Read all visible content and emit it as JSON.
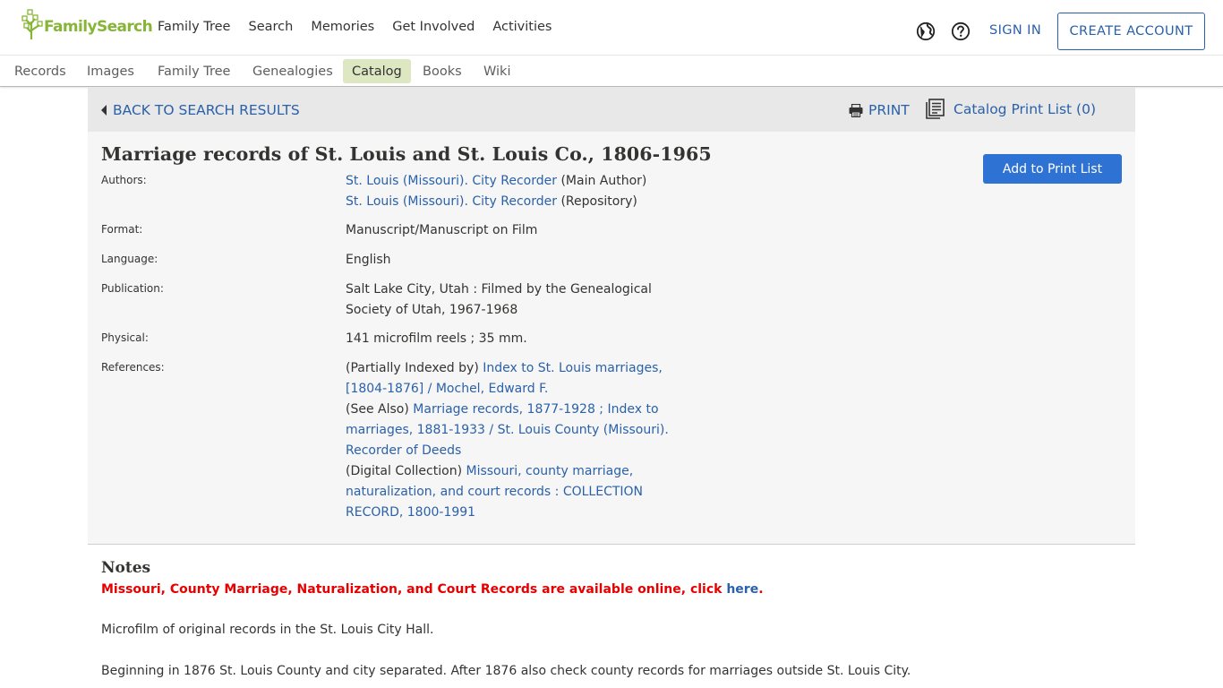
{
  "header": {
    "logo_text": "FamilySearch",
    "nav": [
      "Family Tree",
      "Search",
      "Memories",
      "Get Involved",
      "Activities"
    ],
    "language_icon": "globe-icon",
    "help_icon": "help-circle-icon",
    "sign_in": "SIGN IN",
    "create_account": "CREATE ACCOUNT",
    "brand_color": "#87b537",
    "link_color": "#2b61aa"
  },
  "subnav": {
    "items": [
      "Records",
      "Images",
      "Family Tree",
      "Genealogies",
      "Catalog",
      "Books",
      "Wiki"
    ],
    "active": "Catalog"
  },
  "toolbar": {
    "back": "BACK TO SEARCH RESULTS",
    "print": "PRINT",
    "print_list": "Catalog Print List (0)"
  },
  "record": {
    "title": "Marriage records of St. Louis and St. Louis Co., 1806-1965",
    "add_to_print_list": "Add to Print List",
    "labels": {
      "authors": "Authors:",
      "format": "Format:",
      "language": "Language:",
      "publication": "Publication:",
      "physical": "Physical:",
      "references": "References:"
    },
    "authors": [
      {
        "name": "St. Louis (Missouri). City Recorder",
        "role": "(Main Author)"
      },
      {
        "name": "St. Louis (Missouri). City Recorder",
        "role": "(Repository)"
      }
    ],
    "format": "Manuscript/Manuscript on Film",
    "language": "English",
    "publication": "Salt Lake City, Utah : Filmed by the Genealogical Society of Utah, 1967-1968",
    "physical": "141 microfilm reels ; 35 mm.",
    "references": [
      {
        "prefix": "(Partially Indexed by)",
        "link": "Index to St. Louis marriages, [1804-1876] / Mochel, Edward F."
      },
      {
        "prefix": "(See Also)",
        "link": "Marriage records, 1877-1928 ; Index to marriages, 1881-1933 / St. Louis County (Missouri). Recorder of Deeds"
      },
      {
        "prefix": "(Digital Collection)",
        "link": "Missouri, county marriage, naturalization, and court records : COLLECTION RECORD, 1800-1991"
      }
    ]
  },
  "notes": {
    "title": "Notes",
    "alert": "Missouri, County Marriage, Naturalization, and Court Records are available online, click",
    "alert_link": "here",
    "alert_end": ".",
    "alert_color": "#e60000",
    "paragraphs": [
      "Microfilm of original records in the St. Louis City Hall.",
      "Beginning in 1876 St. Louis County and city separated. After 1876 also check county records for marriages outside St. Louis City."
    ]
  }
}
